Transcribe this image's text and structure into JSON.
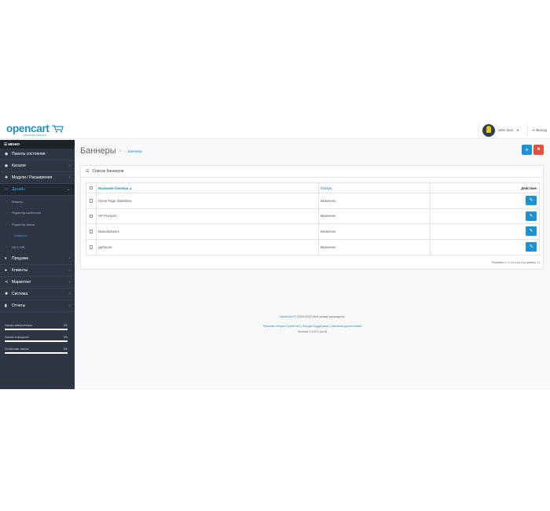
{
  "header": {
    "logo_text": "opencart",
    "logo_subtitle": "русская сборка",
    "user_name": "John Doe",
    "logout_label": "Выход"
  },
  "sidebar": {
    "menu_label": "МЕНЮ",
    "items": [
      {
        "label": "Панель состояния",
        "icon": "dashboard-icon",
        "has_arrow": false
      },
      {
        "label": "Каталог",
        "icon": "tag-icon",
        "has_arrow": true
      },
      {
        "label": "Модули / Расширения",
        "icon": "puzzle-icon",
        "has_arrow": true
      },
      {
        "label": "Дизайн",
        "icon": "monitor-icon",
        "has_arrow": true,
        "active": true
      },
      {
        "label": "Продажи",
        "icon": "cart-icon",
        "has_arrow": true
      },
      {
        "label": "Клиенты",
        "icon": "user-icon",
        "has_arrow": true
      },
      {
        "label": "Маркетинг",
        "icon": "share-icon",
        "has_arrow": true
      },
      {
        "label": "Система",
        "icon": "gear-icon",
        "has_arrow": true
      },
      {
        "label": "Отчеты",
        "icon": "bar-chart-icon",
        "has_arrow": true
      }
    ],
    "design_subitems": [
      {
        "label": "Макеты"
      },
      {
        "label": "Редактор шаблонов"
      },
      {
        "label": "Редактор языка"
      },
      {
        "label": "Баннеры",
        "current": true
      },
      {
        "label": "SEO URL"
      }
    ],
    "stats": [
      {
        "label": "Заказы завершенные",
        "value": "0%"
      },
      {
        "label": "Заказы в процессе",
        "value": "0%"
      },
      {
        "label": "Остальные заказы",
        "value": "0%"
      }
    ]
  },
  "page": {
    "title": "Баннеры",
    "breadcrumb_link": "Баннеры",
    "add_button": "+",
    "delete_button": "✖"
  },
  "panel": {
    "title": "Список баннеров",
    "columns": {
      "name": "Название баннера ▲",
      "status": "Статус",
      "action": "Действие"
    },
    "rows": [
      {
        "name": "Home Page Slideshow",
        "status": "Включено"
      },
      {
        "name": "HP Products",
        "status": "Включено"
      },
      {
        "name": "Manufacturers",
        "status": "Включено"
      },
      {
        "name": "ДоПосле",
        "status": "Включено"
      }
    ],
    "pagination_text": "Показано с 1 по 4 из 4 (страниц: 1)"
  },
  "footer": {
    "copyright_link": "OpenCart",
    "copyright_text": " © 2009-2022 Все права защищены.",
    "link1": "Русская сборка OpenCart",
    "link2": "Форум поддержки",
    "link3": "Магазин дополнений",
    "separator": "|",
    "version": "Version 3.0.2.0 (rs.8)"
  }
}
